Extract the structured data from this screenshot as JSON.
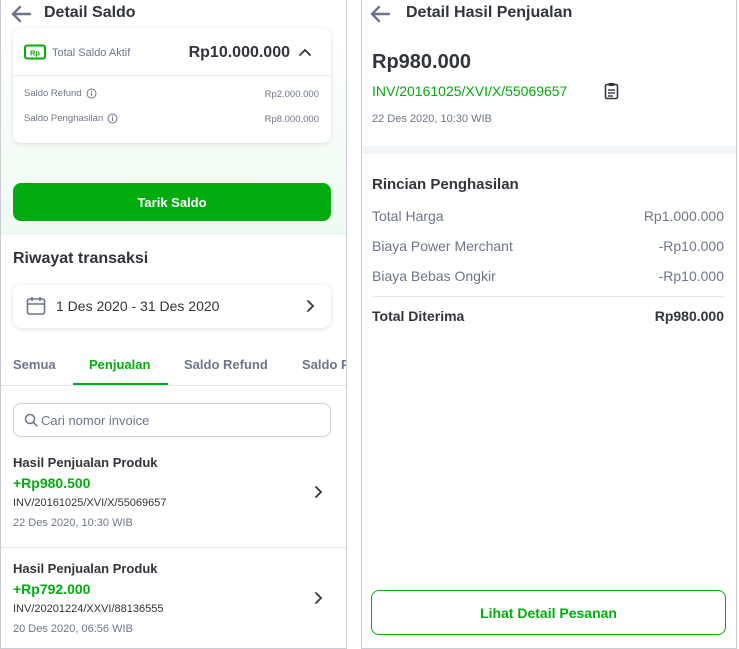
{
  "left": {
    "title": "Detail Saldo",
    "saldo": {
      "label": "Total Saldo Aktif",
      "value": "Rp10.000.000",
      "rows": [
        {
          "label": "Saldo Refund",
          "value": "Rp2.000.000"
        },
        {
          "label": "Saldo Penghasilan",
          "value": "Rp8.000.000"
        }
      ]
    },
    "withdraw_label": "Tarik Saldo",
    "history_title": "Riwayat transaksi",
    "date_range": "1 Des 2020 - 31 Des 2020",
    "tabs": [
      {
        "label": "Semua",
        "active": false
      },
      {
        "label": "Penjualan",
        "active": true
      },
      {
        "label": "Saldo Refund",
        "active": false
      },
      {
        "label": "Saldo Penghasilan",
        "active": false
      }
    ],
    "search": {
      "placeholder": "Cari nomor invoice",
      "value": ""
    },
    "transactions": [
      {
        "title": "Hasil Penjualan Produk",
        "amount": "+Rp980.500",
        "invoice": "INV/20161025/XVI/X/55069657",
        "date": "22 Des 2020, 10:30 WIB"
      },
      {
        "title": "Hasil Penjualan Produk",
        "amount": "+Rp792.000",
        "invoice": "INV/20201224/XXVI/88136555",
        "date": "20 Des 2020, 06:56 WIB"
      }
    ]
  },
  "right": {
    "title": "Detail Hasil Penjualan",
    "amount": "Rp980.000",
    "invoice": "INV/20161025/XVI/X/55069657",
    "date": "22 Des 2020, 10:30 WIB",
    "section_title": "Rincian Penghasilan",
    "lines": [
      {
        "label": "Total Harga",
        "value": "Rp1.000.000"
      },
      {
        "label": "Biaya Power Merchant",
        "value": "-Rp10.000"
      },
      {
        "label": "Biaya Bebas Ongkir",
        "value": "-Rp10.000"
      }
    ],
    "total": {
      "label": "Total Diterima",
      "value": "Rp980.000"
    },
    "button_label": "Lihat Detail Pesanan"
  },
  "colors": {
    "accent": "#03ac0e",
    "text": "#31353b",
    "muted": "#6d7588",
    "divider": "#e4e6e9"
  },
  "icons": [
    "back-arrow-icon",
    "saldo-rp-icon",
    "chevron-up-icon",
    "info-icon",
    "calendar-icon",
    "chevron-right-icon",
    "search-icon",
    "copy-icon"
  ]
}
